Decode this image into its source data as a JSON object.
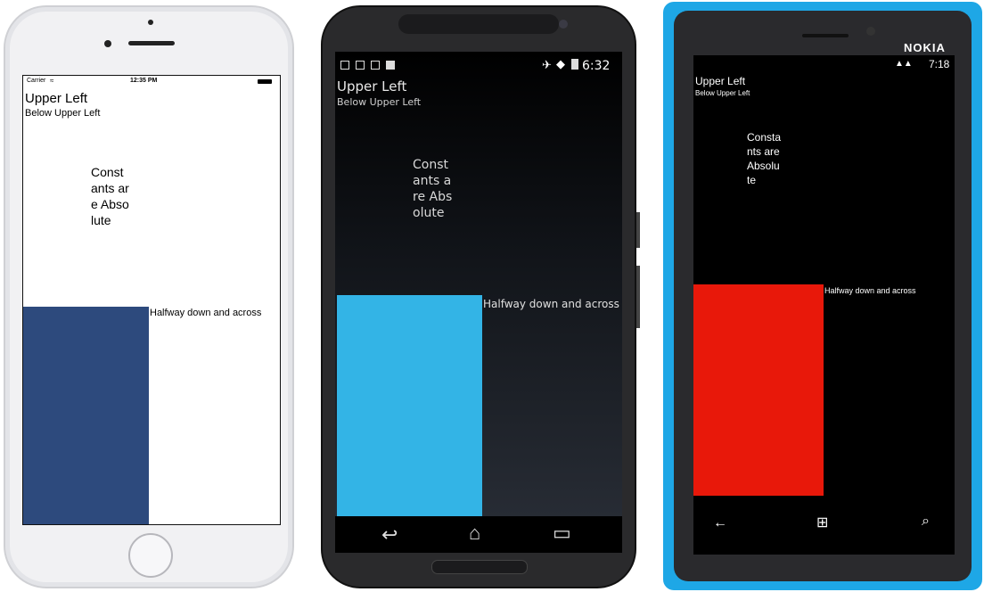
{
  "iphone": {
    "carrier": "Carrier",
    "wifi": "῰",
    "time": "12:35 PM",
    "upper_left": "Upper Left",
    "below_upper_left": "Below Upper Left",
    "constants_text": "Constants are Absolute",
    "halfway": "Halfway down and across",
    "box_color": "#2d4a7d"
  },
  "android": {
    "time": "6:32",
    "upper_left": "Upper Left",
    "below_upper_left": "Below Upper Left",
    "constants_text": "Constants are Absolute",
    "halfway": "Halfway down and across",
    "box_color": "#33b4e6",
    "nav": {
      "back_icon": "back-icon",
      "home_icon": "home-icon",
      "recents_icon": "recents-icon"
    }
  },
  "nokia": {
    "brand": "NOKIA",
    "time": "7:18",
    "upper_left": "Upper Left",
    "below_upper_left": "Below Upper Left",
    "constants_text": "Constants are Absolute",
    "halfway": "Halfway down and across",
    "box_color": "#e8180a",
    "nav": {
      "back_icon": "back-arrow-icon",
      "start_icon": "windows-start-icon",
      "search_icon": "search-icon"
    }
  }
}
